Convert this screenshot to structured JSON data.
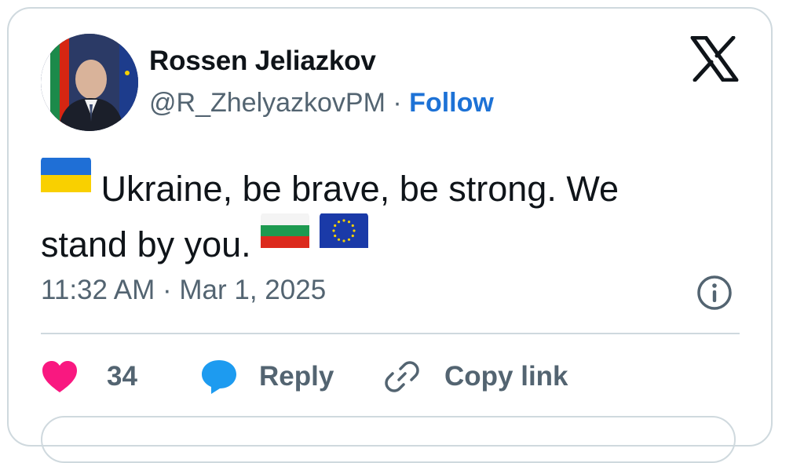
{
  "author": {
    "name": "Rossen Jeliazkov",
    "handle": "@R_ZhelyazkovPM",
    "separator": "·",
    "follow_label": "Follow"
  },
  "tweet": {
    "text_part1": "Ukraine, be brave, be strong. We",
    "text_part2": "stand by you.",
    "flags": [
      "ukraine-flag",
      "bulgaria-flag",
      "eu-flag"
    ]
  },
  "meta": {
    "timestamp": "11:32 AM · Mar 1, 2025"
  },
  "actions": {
    "likes_count": "34",
    "reply_label": "Reply",
    "copy_link_label": "Copy link"
  },
  "colors": {
    "follow_blue": "#1d72d6",
    "like_pink": "#f91880",
    "reply_blue": "#1d9bf0",
    "muted": "#536471",
    "border": "#cfd9de"
  },
  "icons": [
    "x-logo-icon",
    "info-icon",
    "heart-icon",
    "reply-bubble-icon",
    "link-icon"
  ]
}
